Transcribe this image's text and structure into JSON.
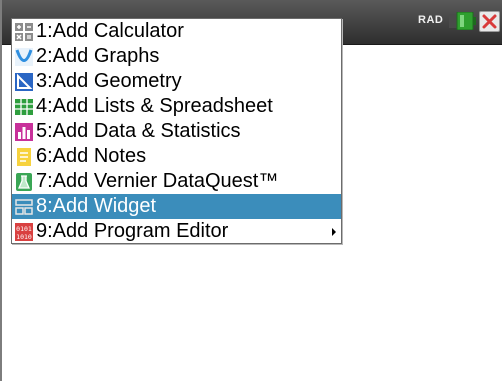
{
  "status": {
    "angle_mode": "RAD"
  },
  "menu": {
    "selected_index": 7,
    "items": [
      {
        "label": "1:Add Calculator",
        "icon": "calculator-icon"
      },
      {
        "label": "2:Add Graphs",
        "icon": "graphs-icon"
      },
      {
        "label": "3:Add Geometry",
        "icon": "geometry-icon"
      },
      {
        "label": "4:Add Lists & Spreadsheet",
        "icon": "spreadsheet-icon"
      },
      {
        "label": "5:Add Data & Statistics",
        "icon": "data-statistics-icon"
      },
      {
        "label": "6:Add Notes",
        "icon": "notes-icon"
      },
      {
        "label": "7:Add Vernier DataQuest™",
        "icon": "dataquest-icon"
      },
      {
        "label": "8:Add Widget",
        "icon": "widget-icon"
      },
      {
        "label": "9:Add Program Editor",
        "icon": "program-editor-icon",
        "has_submenu": true
      }
    ]
  },
  "colors": {
    "selection": "#3b8dbb",
    "topbar": "#3a3a3a",
    "battery": "#2fa02f",
    "close": "#d93a3a"
  }
}
